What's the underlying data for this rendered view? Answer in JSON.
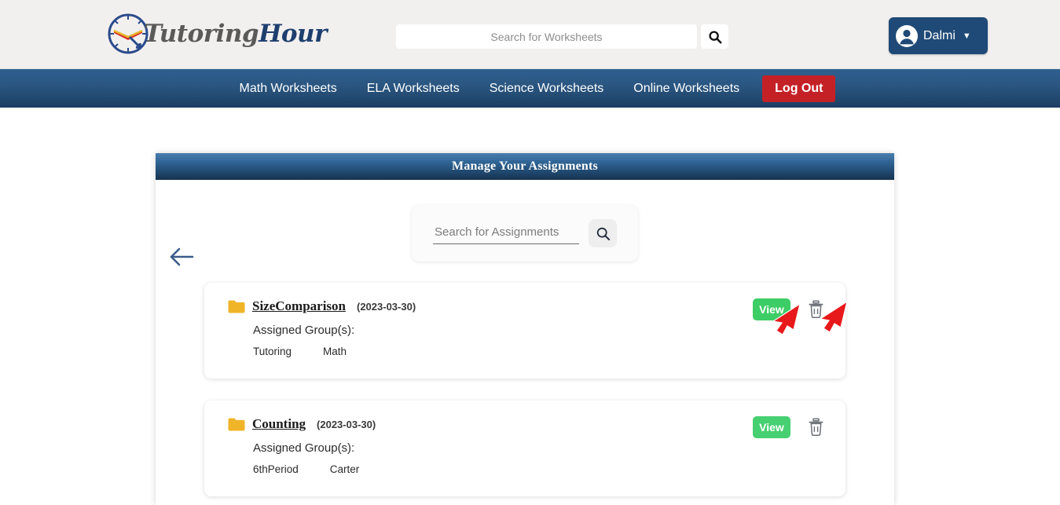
{
  "header": {
    "logo": {
      "part1": "Tutoring",
      "part2": "Hour",
      "icon": "clock-icon"
    },
    "search": {
      "placeholder": "Search for Worksheets",
      "value": "",
      "button_icon": "search-icon"
    },
    "user": {
      "name": "Dalmi",
      "avatar_icon": "person-icon",
      "caret_icon": "chevron-down-icon"
    }
  },
  "nav": {
    "items": [
      {
        "label": "Math Worksheets"
      },
      {
        "label": "ELA Worksheets"
      },
      {
        "label": "Science Worksheets"
      },
      {
        "label": "Online Worksheets"
      }
    ],
    "logout_label": "Log Out",
    "logout_color": "#c42127"
  },
  "panel": {
    "title": "Manage Your Assignments",
    "back_icon": "arrow-left-icon",
    "search": {
      "placeholder": "Search for Assignments",
      "value": "",
      "button_icon": "search-icon"
    },
    "groups_label": "Assigned Group(s):",
    "view_label": "View",
    "view_color": "#47d072",
    "delete_icon": "trash-icon",
    "folder_icon": "folder-icon",
    "assignments": [
      {
        "name": "SizeComparison",
        "date": "(2023-03-30)",
        "groups": [
          "Tutoring",
          "Math"
        ]
      },
      {
        "name": "Counting",
        "date": "(2023-03-30)",
        "groups": [
          "6thPeriod",
          "Carter"
        ]
      }
    ]
  },
  "annotations": {
    "view_pointer_icon": "red-arrow-cursor",
    "delete_pointer_icon": "red-arrow-cursor"
  }
}
